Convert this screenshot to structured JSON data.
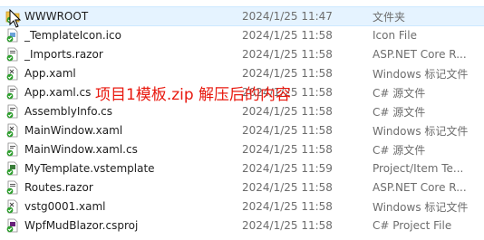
{
  "colors": {
    "selection": "#e5f3ff",
    "overlay_text": "#e8190f",
    "sync_check": "#2e9e2e",
    "secondary_text": "#6d6d6d"
  },
  "overlay_text": "项目1模板.zip 解压后的内容",
  "rows": [
    {
      "name": "WWWROOT",
      "date": "2024/1/25 11:47",
      "type": "文件夹",
      "icon": "folder-icon"
    },
    {
      "name": "_TemplateIcon.ico",
      "date": "2024/1/25 11:58",
      "type": "Icon File",
      "icon": "image-file-icon"
    },
    {
      "name": "_Imports.razor",
      "date": "2024/1/25 11:58",
      "type": "ASP.NET Core R...",
      "icon": "razor-file-icon"
    },
    {
      "name": "App.xaml",
      "date": "2024/1/25 11:58",
      "type": "Windows 标记文件",
      "icon": "xaml-file-icon"
    },
    {
      "name": "App.xaml.cs",
      "date": "2024/1/25 11:58",
      "type": "C# 源文件",
      "icon": "csharp-file-icon"
    },
    {
      "name": "AssemblyInfo.cs",
      "date": "2024/1/25 11:58",
      "type": "C# 源文件",
      "icon": "csharp-file-icon"
    },
    {
      "name": "MainWindow.xaml",
      "date": "2024/1/25 11:58",
      "type": "Windows 标记文件",
      "icon": "xaml-file-icon"
    },
    {
      "name": "MainWindow.xaml.cs",
      "date": "2024/1/25 11:58",
      "type": "C# 源文件",
      "icon": "csharp-file-icon"
    },
    {
      "name": "MyTemplate.vstemplate",
      "date": "2024/1/25 11:59",
      "type": "Project/Item Te...",
      "icon": "template-file-icon"
    },
    {
      "name": "Routes.razor",
      "date": "2024/1/25 11:58",
      "type": "ASP.NET Core R...",
      "icon": "razor-file-icon"
    },
    {
      "name": "vstg0001.xaml",
      "date": "2024/1/25 11:58",
      "type": "Windows 标记文件",
      "icon": "xaml-file-icon"
    },
    {
      "name": "WpfMudBlazor.csproj",
      "date": "2024/1/25 11:58",
      "type": "C# Project File",
      "icon": "csproj-file-icon"
    }
  ]
}
